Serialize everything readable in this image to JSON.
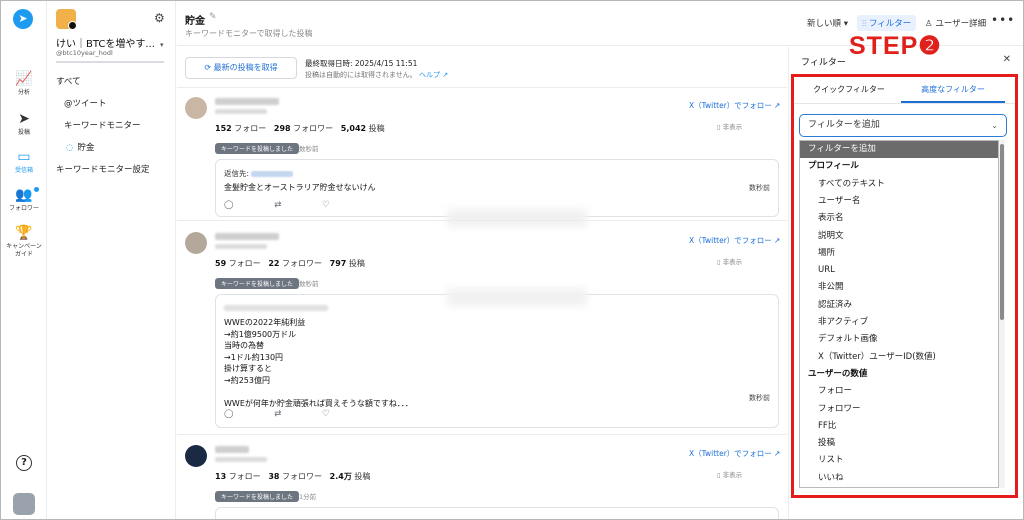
{
  "rail": {
    "items": [
      {
        "icon": "chart-line-icon",
        "glyph": "📈",
        "label": "分析"
      },
      {
        "icon": "send-icon",
        "glyph": "➤",
        "label": "投稿"
      },
      {
        "icon": "inbox-icon",
        "glyph": "▭",
        "label": "受信箱"
      },
      {
        "icon": "people-icon",
        "glyph": "👥",
        "label": "フォロワー"
      },
      {
        "icon": "trophy-icon",
        "glyph": "🏆",
        "label": "キャンペーンガイド"
      }
    ],
    "help_glyph": "?"
  },
  "account": {
    "name": "けい｜BTCを増やす...",
    "handle": "@btc10year_hodl",
    "caret": "▾",
    "gear": "⚙"
  },
  "nav": {
    "all": "すべて",
    "tweet": "@ツイート",
    "keyword": "キーワードモニター",
    "selected": "貯金",
    "selected_icon": "◌",
    "settings": "キーワードモニター設定"
  },
  "header": {
    "title": "貯金",
    "edit_glyph": "✎",
    "subtitle": "キーワードモニターで取得した投稿",
    "sort": "新しい順 ▾",
    "filter": "⫶⫶ フィルター",
    "user_detail": "♙ ユーザー詳細",
    "more": "•••"
  },
  "feed": {
    "refresh_label": "⟳  最新の投稿を取得",
    "last_fetch": "最終取得日時: 2025/4/15 11:51",
    "auto_note": "投稿は自動的には取得されません。",
    "help_link": "ヘルプ ↗",
    "posts": [
      {
        "stats": {
          "following": "152",
          "following_label": "フォロー",
          "followers": "298",
          "followers_label": "フォロワー",
          "posts": "5,042",
          "posts_label": "投稿"
        },
        "follow": "X（Twitter）でフォロー ↗",
        "hide": "▯ 非表示",
        "tag": "キーワードを投稿しました",
        "time": "数秒前",
        "reply_prefix": "返信先:",
        "text": "金髪貯金とオーストラリア貯金せないけん",
        "card_time": "数秒前",
        "actions": "◯ ⇄ ♡"
      },
      {
        "stats": {
          "following": "59",
          "following_label": "フォロー",
          "followers": "22",
          "followers_label": "フォロワー",
          "posts": "797",
          "posts_label": "投稿"
        },
        "follow": "X（Twitter）でフォロー ↗",
        "hide": "▯ 非表示",
        "tag": "キーワードを投稿しました",
        "time": "数秒前",
        "text": "WWEの2022年純利益\n→約1億9500万ドル\n当時の為替\n→1ドル約130円\n掛け算すると\n→約253億円\n\nWWEが何年か貯金頑張れば買えそうな額ですね．．．",
        "card_time": "数秒前",
        "actions": "◯ ⇄ ♡"
      },
      {
        "stats": {
          "following": "13",
          "following_label": "フォロー",
          "followers": "38",
          "followers_label": "フォロワー",
          "posts": "2.4万",
          "posts_label": "投稿"
        },
        "follow": "X（Twitter）でフォロー ↗",
        "hide": "▯ 非表示",
        "tag": "キーワードを投稿しました",
        "time": "1分前"
      }
    ]
  },
  "panel": {
    "title": "フィルター",
    "close": "✕",
    "step": "STEP❷",
    "tabs": [
      "クイックフィルター",
      "高度なフィルター"
    ],
    "select_placeholder": "フィルターを追加",
    "select_chevron": "⌄",
    "options": [
      {
        "label": "フィルターを追加",
        "kind": "sel"
      },
      {
        "label": "プロフィール",
        "kind": "hdr"
      },
      {
        "label": "すべてのテキスト",
        "kind": "sub"
      },
      {
        "label": "ユーザー名",
        "kind": "sub"
      },
      {
        "label": "表示名",
        "kind": "sub"
      },
      {
        "label": "説明文",
        "kind": "sub"
      },
      {
        "label": "場所",
        "kind": "sub"
      },
      {
        "label": "URL",
        "kind": "sub"
      },
      {
        "label": "非公開",
        "kind": "sub"
      },
      {
        "label": "認証済み",
        "kind": "sub"
      },
      {
        "label": "非アクティブ",
        "kind": "sub"
      },
      {
        "label": "デフォルト画像",
        "kind": "sub"
      },
      {
        "label": "X（Twitter）ユーザーID(数値)",
        "kind": "sub"
      },
      {
        "label": "ユーザーの数値",
        "kind": "hdr"
      },
      {
        "label": "フォロー",
        "kind": "sub"
      },
      {
        "label": "フォロワー",
        "kind": "sub"
      },
      {
        "label": "FF比",
        "kind": "sub"
      },
      {
        "label": "投稿",
        "kind": "sub"
      },
      {
        "label": "リスト",
        "kind": "sub"
      },
      {
        "label": "いいね",
        "kind": "sub"
      }
    ]
  },
  "colors": {
    "accent": "#1d9bf0",
    "link": "#1d6fd8",
    "highlight_box": "#e51c1c"
  }
}
